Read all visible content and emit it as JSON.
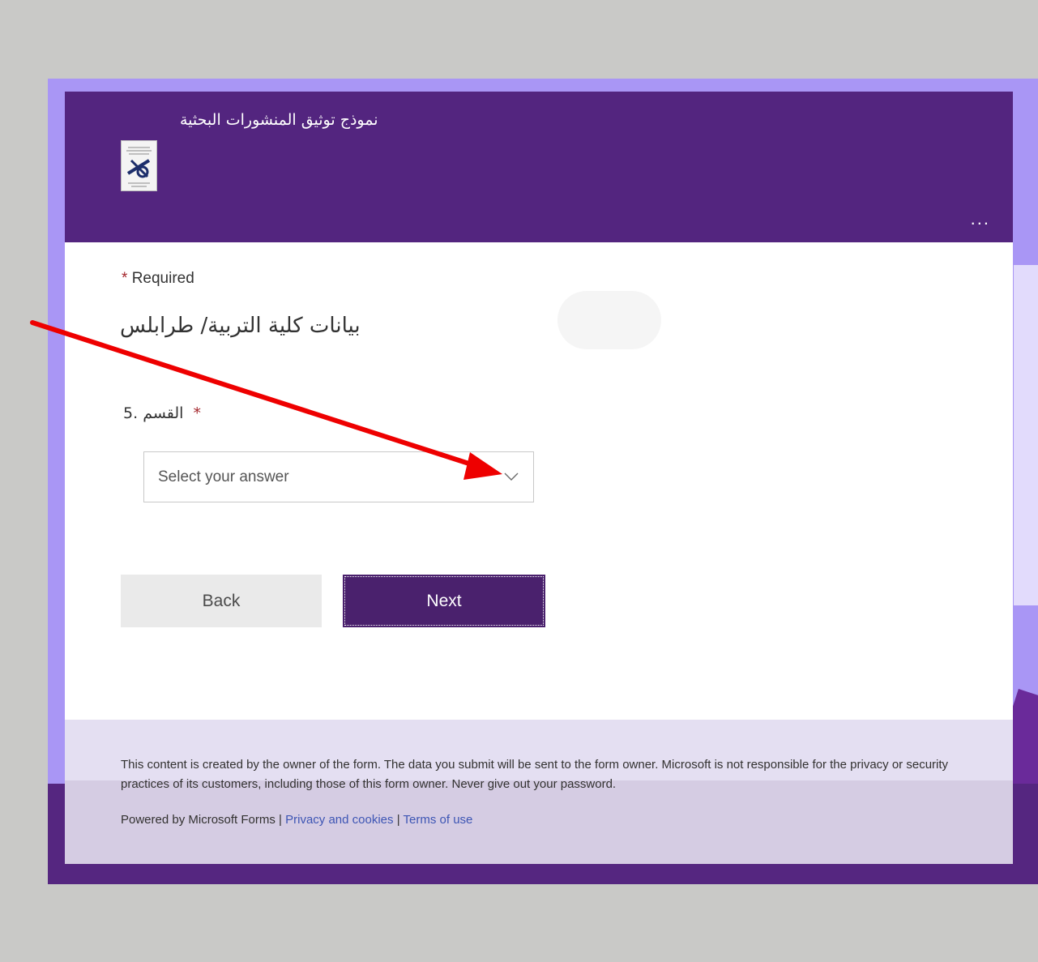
{
  "header": {
    "form_title": "نموذج توثيق المنشورات البحثية",
    "more_label": "...",
    "accent_color": "#53257f"
  },
  "form": {
    "required_marker": "*",
    "required_label": "Required",
    "section_title": "بيانات كلية  التربية/ طرابلس",
    "question": {
      "number": "5.",
      "text": "القسم",
      "required_marker": "*"
    },
    "dropdown": {
      "placeholder": "Select your answer",
      "icon": "chevron-down-icon"
    },
    "buttons": {
      "back_label": "Back",
      "next_label": "Next"
    }
  },
  "footer": {
    "disclaimer": "This content is created by the owner of the form. The data you submit will be sent to the form owner. Microsoft is not responsible for the privacy or security practices of its customers, including those of this form owner. Never give out your password.",
    "powered_by": "Powered by Microsoft Forms |",
    "privacy_link": "Privacy and cookies",
    "separator": "|",
    "terms_link": "Terms of use"
  },
  "annotation": {
    "arrow_color": "#ee0000"
  }
}
